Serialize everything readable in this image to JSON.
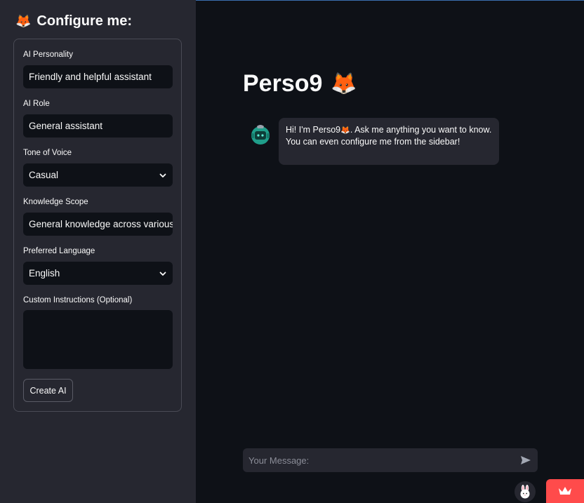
{
  "sidebar": {
    "title": "Configure me:",
    "title_emoji": "🦊",
    "fields": {
      "personality_label": "AI Personality",
      "personality_value": "Friendly and helpful assistant",
      "role_label": "AI Role",
      "role_value": "General assistant",
      "tone_label": "Tone of Voice",
      "tone_value": "Casual",
      "scope_label": "Knowledge Scope",
      "scope_value": "General knowledge across various topics",
      "language_label": "Preferred Language",
      "language_value": "English",
      "instructions_label": "Custom Instructions (Optional)",
      "instructions_value": ""
    },
    "create_button": "Create AI"
  },
  "main": {
    "title": "Perso9",
    "title_emoji": "🦊",
    "message": {
      "part1": "Hi! I'm Perso9",
      "emoji": "🦊",
      "part2": ". Ask me anything you want to know. You can even configure me from the sidebar!"
    },
    "chat_placeholder": "Your Message:"
  },
  "colors": {
    "background": "#0e1117",
    "sidebar": "#262730",
    "accent": "#ff4b4b",
    "avatar": "#1f9e8a"
  },
  "icons": [
    "fox-emoji",
    "chevron-down-icon",
    "send-icon",
    "robot-avatar-icon",
    "bunny-icon",
    "crown-icon"
  ]
}
